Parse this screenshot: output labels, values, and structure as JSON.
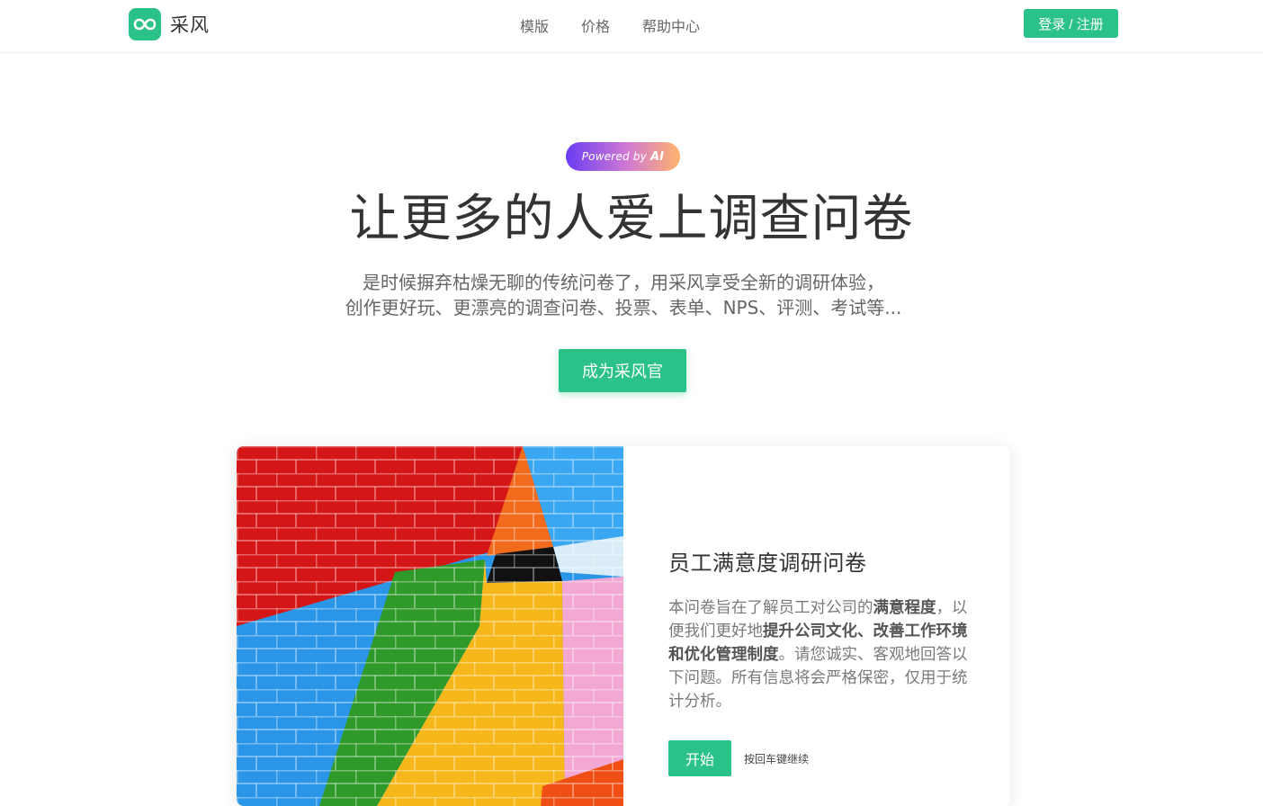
{
  "colors": {
    "brand_green": "#2bc28a",
    "badge_gradient": [
      "#6a3cf2",
      "#d27bd2",
      "#ffb36b"
    ]
  },
  "navbar": {
    "logo_icon": "infinity-icon",
    "brand": "采风",
    "links": [
      "模版",
      "价格",
      "帮助中心"
    ],
    "login_label": "登录 / 注册"
  },
  "hero": {
    "badge_prefix": "Powered by",
    "badge_strong": "AI",
    "title": "让更多的人爱上调查问卷",
    "subtitle_line1": "是时候摒弃枯燥无聊的传统问卷了，用采风享受全新的调研体验，",
    "subtitle_line2": "创作更好玩、更漂亮的调查问卷、投票、表单、NPS、评测、考试等...",
    "cta_label": "成为采风官"
  },
  "card": {
    "image_desc": "colorful-painted-brick-wall",
    "title": "员工满意度调研问卷",
    "desc_parts": {
      "p1": "本问卷旨在了解员工对公司的",
      "b1": "满意程度",
      "p2": "，以便我们更好地",
      "b2": "提升公司文化、改善工作环境和优化管理制度",
      "p3": "。请您诚实、客观地回答以下问题。所有信息将会严格保密，仅用于统计分析。"
    },
    "start_label": "开始",
    "hint": "按回车键继续"
  }
}
